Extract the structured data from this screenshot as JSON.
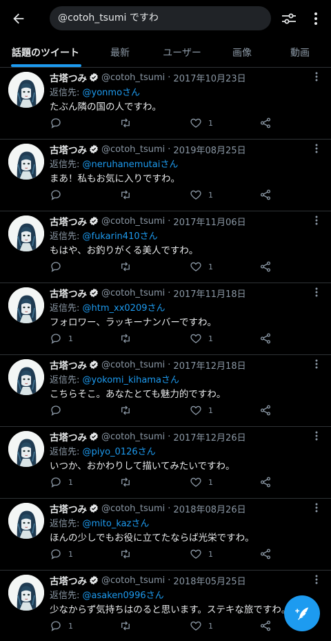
{
  "search": {
    "query": "@cotoh_tsumi ですわ"
  },
  "tabs": [
    {
      "label": "話題のツイート",
      "active": true
    },
    {
      "label": "最新",
      "active": false
    },
    {
      "label": "ユーザー",
      "active": false
    },
    {
      "label": "画像",
      "active": false
    },
    {
      "label": "動画",
      "active": false
    }
  ],
  "author": {
    "name": "古塔つみ",
    "handle": "@cotoh_tsumi"
  },
  "reply_label": "返信先: ",
  "colors": {
    "accent": "#1d9bf0",
    "background": "#000000",
    "muted": "#8b98a5",
    "divider": "#2f3336"
  },
  "tweets": [
    {
      "date": "2017年10月23日",
      "reply_to": "@yonmoさん",
      "text": "たぶん隣の国の人ですわ。",
      "replies": "",
      "retweets": "",
      "likes": "1"
    },
    {
      "date": "2019年08月25日",
      "reply_to": "@neruhanemutaiさん",
      "text": "まあ！私もお気に入りですわ。",
      "replies": "",
      "retweets": "",
      "likes": "1"
    },
    {
      "date": "2017年11月06日",
      "reply_to": "@fukarin410さん",
      "text": "もはや、お釣りがくる美人ですわ。",
      "replies": "",
      "retweets": "",
      "likes": "1"
    },
    {
      "date": "2017年11月18日",
      "reply_to": "@htm_xx0209さん",
      "text": "フォロワー、ラッキーナンバーですわ。",
      "replies": "1",
      "retweets": "",
      "likes": "1"
    },
    {
      "date": "2017年12月18日",
      "reply_to": "@yokomi_kihamaさん",
      "text": "こちらそこ。あなたとても魅力的ですわ。",
      "replies": "",
      "retweets": "",
      "likes": "1"
    },
    {
      "date": "2017年12月26日",
      "reply_to": "@piyo_0126さん",
      "text": "いつか、おかわりして描いてみたいですわ。",
      "replies": "1",
      "retweets": "",
      "likes": "1"
    },
    {
      "date": "2018年08月26日",
      "reply_to": "@mito_kazさん",
      "text": "ほんの少しでもお役に立てたならば光栄ですわ。",
      "replies": "1",
      "retweets": "",
      "likes": "1"
    },
    {
      "date": "2018年05月25日",
      "reply_to": "@asaken0996さん",
      "text": "少なからず気持ちはのると思います。ステキな旅ですわ。",
      "replies": "1",
      "retweets": "",
      "likes": "1"
    }
  ],
  "icons": {
    "back": "arrow-left-icon",
    "filter": "sliders-icon",
    "more": "more-vertical-icon",
    "verified": "verified-badge-icon",
    "reply": "reply-icon",
    "retweet": "retweet-icon",
    "like": "heart-icon",
    "share": "share-icon",
    "compose": "compose-tweet-icon"
  }
}
